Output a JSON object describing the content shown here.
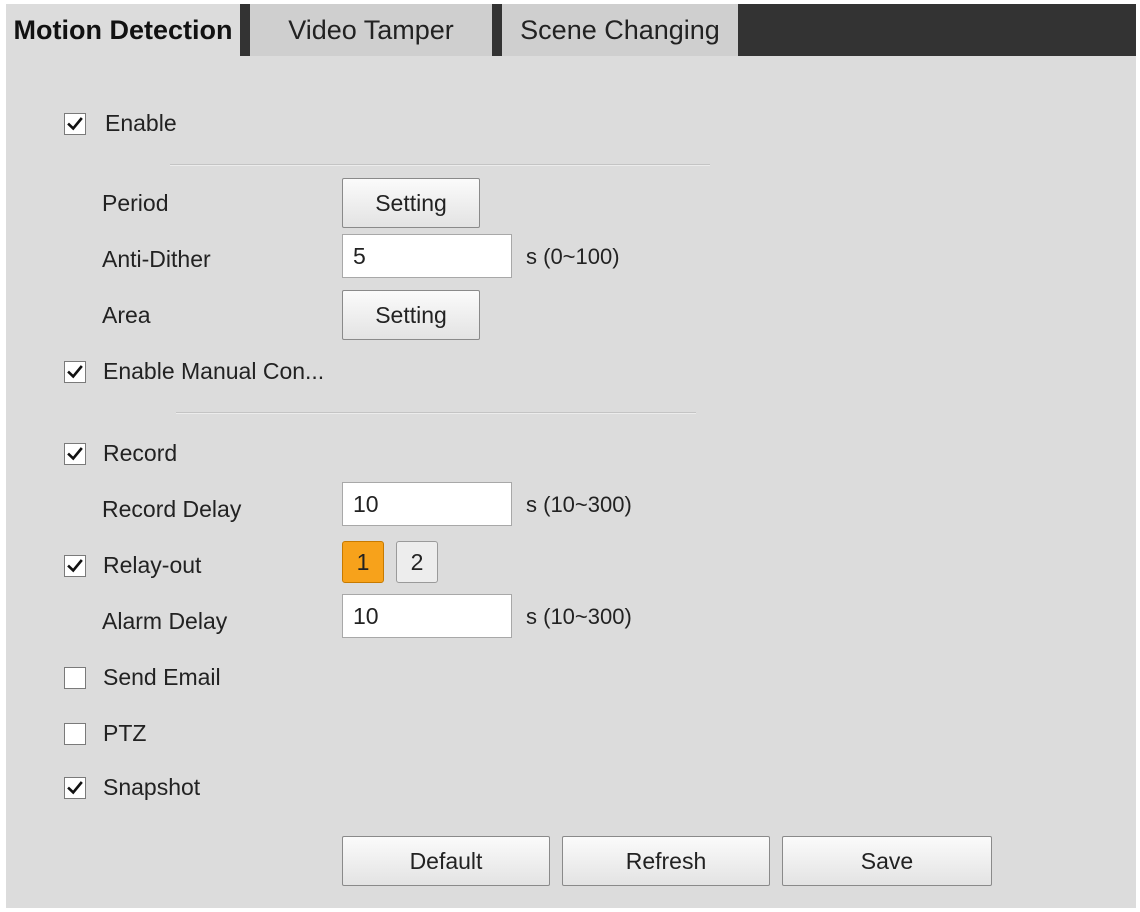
{
  "tabs": [
    {
      "label": "Motion Detection",
      "active": true
    },
    {
      "label": "Video Tamper",
      "active": false
    },
    {
      "label": "Scene Changing",
      "active": false
    }
  ],
  "enable": {
    "label": "Enable",
    "checked": true
  },
  "period": {
    "label": "Period",
    "button": "Setting"
  },
  "anti_dither": {
    "label": "Anti-Dither",
    "value": "5",
    "unit": "s (0~100)"
  },
  "area": {
    "label": "Area",
    "button": "Setting"
  },
  "manual_control": {
    "label": "Enable Manual Con...",
    "checked": true
  },
  "record": {
    "label": "Record",
    "checked": true
  },
  "record_delay": {
    "label": "Record Delay",
    "value": "10",
    "unit": "s (10~300)"
  },
  "relay_out": {
    "label": "Relay-out",
    "checked": true,
    "channels": [
      {
        "label": "1",
        "selected": true
      },
      {
        "label": "2",
        "selected": false
      }
    ]
  },
  "alarm_delay": {
    "label": "Alarm Delay",
    "value": "10",
    "unit": "s (10~300)"
  },
  "send_email": {
    "label": "Send Email",
    "checked": false
  },
  "ptz": {
    "label": "PTZ",
    "checked": false
  },
  "snapshot": {
    "label": "Snapshot",
    "checked": true
  },
  "buttons": {
    "default": "Default",
    "refresh": "Refresh",
    "save": "Save"
  },
  "colors": {
    "relay_selected": "#f7a21b",
    "tab_bar": "#333333",
    "panel": "#dcdcdc"
  }
}
